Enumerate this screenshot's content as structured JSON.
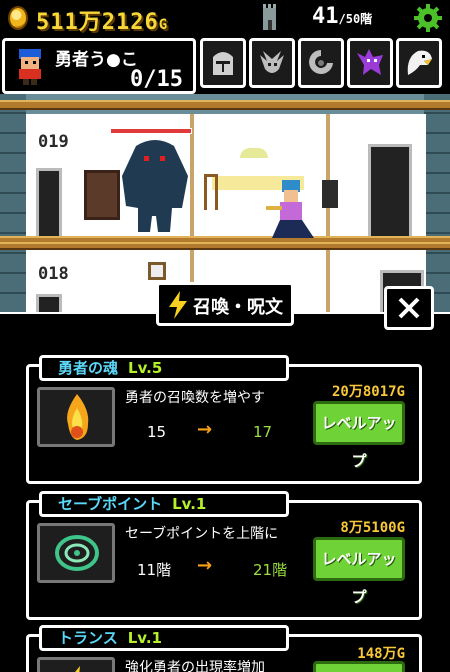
{
  "hud": {
    "gold_main": "511万2126",
    "gold_unit": "G",
    "floor_current": "41",
    "floor_total": "/50階"
  },
  "hero": {
    "name": "勇者う●こ",
    "count": "0/15"
  },
  "monsters": [
    "knight-helmet-icon",
    "dragon-icon",
    "serpent-icon",
    "wolf-icon",
    "eagle-icon"
  ],
  "scene": {
    "room_upper": "019",
    "room_lower": "018"
  },
  "panel": {
    "title": "召喚・呪文",
    "close_label": "×"
  },
  "skills": [
    {
      "name": "勇者の魂",
      "level": "Lv.5",
      "desc": "勇者の召喚数を増やす",
      "from": "15",
      "to": "17",
      "cost": "20万8017G",
      "button": "レベルアップ",
      "icon": "flame-soul-icon"
    },
    {
      "name": "セーブポイント",
      "level": "Lv.1",
      "desc": "セーブポイントを上階に",
      "from": "11階",
      "to": "21階",
      "cost": "8万5100G",
      "button": "レベルアップ",
      "icon": "green-swirl-icon"
    },
    {
      "name": "トランス",
      "level": "Lv.1",
      "desc": "強化勇者の出現率増加",
      "from": "",
      "to": "",
      "cost": "148万G",
      "button": "",
      "icon": "lightning-icon"
    }
  ],
  "colors": {
    "gold": "#f8d838",
    "skill_name": "#5bd8f8",
    "level": "#b6f02a",
    "level_up_button": "#6fd236",
    "arrow": "#f5a018"
  }
}
